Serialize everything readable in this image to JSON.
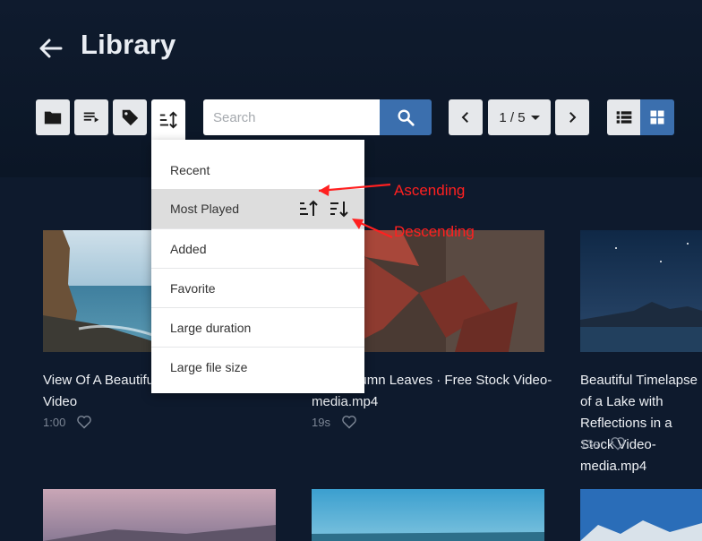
{
  "header": {
    "title": "Library",
    "back_icon": "arrow-left-icon"
  },
  "toolbar": {
    "folder_icon": "folder-icon",
    "playlist_icon": "playlist-icon",
    "tag_icon": "tag-icon",
    "sort_icon": "sort-icon",
    "search_placeholder": "Search",
    "search_value": "",
    "pagination": {
      "prev_icon": "chevron-left-icon",
      "current": "1 / 5",
      "next_icon": "chevron-right-icon"
    },
    "view": {
      "list_icon": "list-view-icon",
      "grid_icon": "grid-view-icon",
      "selected": "grid"
    }
  },
  "sort_menu": {
    "items": [
      {
        "label": "Recent"
      },
      {
        "label": "Most Played",
        "highlighted": true
      },
      {
        "label": "Added"
      },
      {
        "label": "Favorite"
      },
      {
        "label": "Large duration"
      },
      {
        "label": "Large file size"
      }
    ],
    "ascending_icon": "sort-ascending-icon",
    "descending_icon": "sort-descending-icon"
  },
  "annotations": {
    "ascending": "Ascending",
    "descending": "Descending",
    "color": "#ff2020"
  },
  "videos": [
    {
      "title": "View Of A Beautiful Cliff · Free Stock Video",
      "duration": "1:00"
    },
    {
      "title": "Red Autumn Leaves · Free Stock Video-media.mp4",
      "duration": "19s"
    },
    {
      "title": "Beautiful Timelapse of a Lake with Reflections in a Stock Video-media.mp4",
      "duration": "13s"
    }
  ],
  "colors": {
    "background": "#0e1a2d",
    "accent": "#3b6fae",
    "button": "#e6e8eb"
  }
}
